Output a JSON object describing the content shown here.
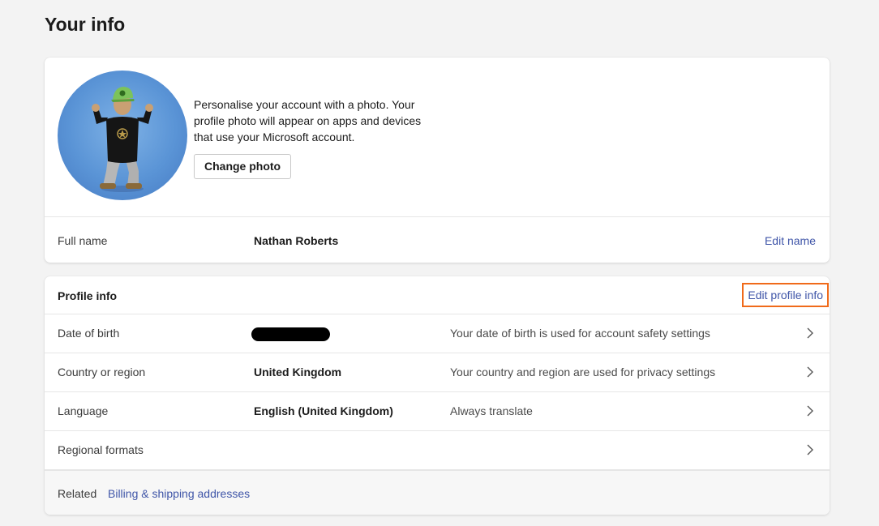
{
  "page": {
    "title": "Your info"
  },
  "photo": {
    "description": "Personalise your account with a photo. Your profile photo will appear on apps and devices that use your Microsoft account.",
    "change_button": "Change photo"
  },
  "full_name": {
    "label": "Full name",
    "value": "Nathan Roberts",
    "edit_link": "Edit name"
  },
  "profile": {
    "title": "Profile info",
    "edit_link": "Edit profile info",
    "rows": [
      {
        "label": "Date of birth",
        "value": "",
        "description": "Your date of birth is used for account safety settings"
      },
      {
        "label": "Country or region",
        "value": "United Kingdom",
        "description": "Your country and region are used for privacy settings"
      },
      {
        "label": "Language",
        "value": "English (United Kingdom)",
        "description": "Always translate"
      },
      {
        "label": "Regional formats",
        "value": "",
        "description": ""
      }
    ],
    "related_label": "Related",
    "related_link": "Billing & shipping addresses"
  },
  "colors": {
    "link": "#3f55a8",
    "highlight": "#f06a1a",
    "background": "#f3f3f3"
  }
}
